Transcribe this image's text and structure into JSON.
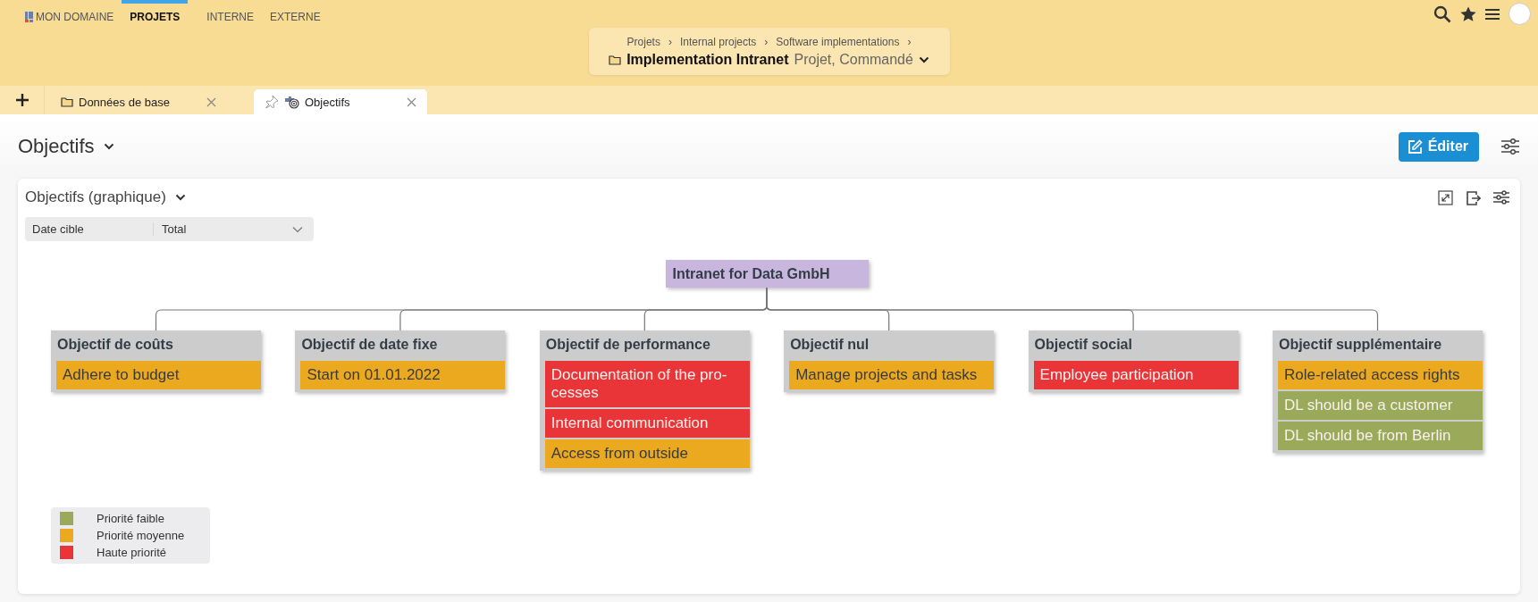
{
  "nav": {
    "items": [
      {
        "label": "MON DOMAINE",
        "selected": false,
        "kind": "domain"
      },
      {
        "label": "PROJETS",
        "selected": true,
        "kind": "plain"
      },
      {
        "label": "INTERNE",
        "selected": false,
        "kind": "plain"
      },
      {
        "label": "EXTERNE",
        "selected": false,
        "kind": "plain"
      }
    ]
  },
  "breadcrumb": {
    "path": [
      {
        "label": "Projets",
        "separator": "›"
      },
      {
        "label": "Internal projects",
        "separator": "›"
      },
      {
        "label": "Software implementations",
        "separator": "›"
      }
    ],
    "title": "Implementation Intranet",
    "subtitle": "Projet, Commandé"
  },
  "tabs": [
    {
      "label": "Données de base",
      "selected": false,
      "kind": "folder"
    },
    {
      "label": "Objectifs",
      "selected": true,
      "kind": "goals"
    }
  ],
  "page": {
    "title": "Objectifs",
    "edit_button": "Éditer"
  },
  "card": {
    "title": "Objectifs (graphique)",
    "filter": {
      "label": "Date cible",
      "value": "Total"
    },
    "diagram": {
      "root": "Intranet for Data GmbH",
      "groups": [
        {
          "title": "Objectif de coûts",
          "items": [
            {
              "text": "Adhere to budget",
              "color": "#eba91f"
            }
          ]
        },
        {
          "title": "Objectif de date fixe",
          "items": [
            {
              "text": "Start on 01.01.2022",
              "color": "#eba91f"
            }
          ]
        },
        {
          "title": "Objectif de performance",
          "items": [
            {
              "text": "Documentation of the pro-cesses",
              "color": "#e93538"
            },
            {
              "text": "Internal communication",
              "color": "#e93538"
            },
            {
              "text": "Access from outside",
              "color": "#eba91f"
            }
          ]
        },
        {
          "title": "Objectif nul",
          "items": [
            {
              "text": "Manage projects and tasks",
              "color": "#eba91f"
            }
          ]
        },
        {
          "title": "Objectif social",
          "items": [
            {
              "text": "Employee participation",
              "color": "#e93538"
            }
          ]
        },
        {
          "title": "Objectif supplémentaire",
          "items": [
            {
              "text": "Role-related access rights",
              "color": "#eba91f"
            },
            {
              "text": "DL should be a customer",
              "color": "#9aa95a"
            },
            {
              "text": "DL should be from Berlin",
              "color": "#9aa95a"
            }
          ]
        }
      ]
    },
    "legend": [
      {
        "label": "Priorité faible",
        "color": "#9aa95a"
      },
      {
        "label": "Priorité moyenne",
        "color": "#eba91f"
      },
      {
        "label": "Haute priorité",
        "color": "#e93538"
      }
    ]
  }
}
